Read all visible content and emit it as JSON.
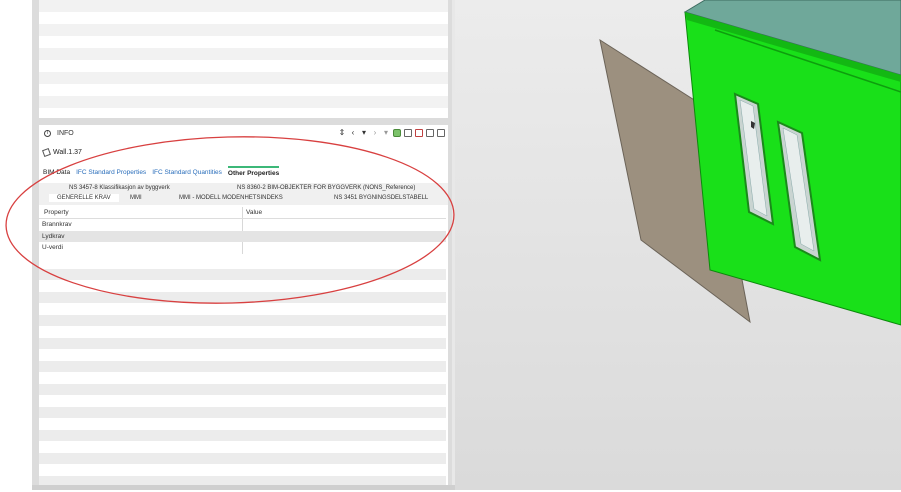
{
  "info_panel": {
    "title": "INFO",
    "entity_name": "Wall.1.37"
  },
  "main_tabs": [
    {
      "label": "BIM Data",
      "active": false
    },
    {
      "label": "IFC Standard Properties",
      "active": false
    },
    {
      "label": "IFC Standard Quantities",
      "active": false
    },
    {
      "label": "Other Properties",
      "active": true
    }
  ],
  "sub_tabs": {
    "row1": [
      "NS 3457-8 Klassifikasjon av byggverk",
      "NS 8360-2 BIM-OBJEKTER FOR BYGGVERK (NONS_Reference)"
    ],
    "row2": [
      "GENERELLE KRAV",
      "MMI",
      "MMI - MODELL MODENHETSINDEKS",
      "NS 3451 BYGNINGSDELSTABELL"
    ]
  },
  "table": {
    "headers": [
      "Property",
      "Value"
    ],
    "rows": [
      {
        "property": "Brannkrav",
        "value": ""
      },
      {
        "property": "Lydkrav",
        "value": ""
      },
      {
        "property": "U-verdi",
        "value": ""
      }
    ]
  },
  "colors": {
    "wall_green": "#19e019",
    "accent_tab": "#3cb878",
    "link_blue": "#2a6ebb",
    "annotation_red": "#d84040"
  },
  "icons": [
    "info-icon",
    "wall-icon",
    "sort-icon",
    "chevron-left-icon",
    "triangle-down-icon",
    "chevron-right-icon",
    "filter-icon",
    "green-box-icon",
    "box-icon",
    "red-box-icon",
    "layout-icon"
  ]
}
